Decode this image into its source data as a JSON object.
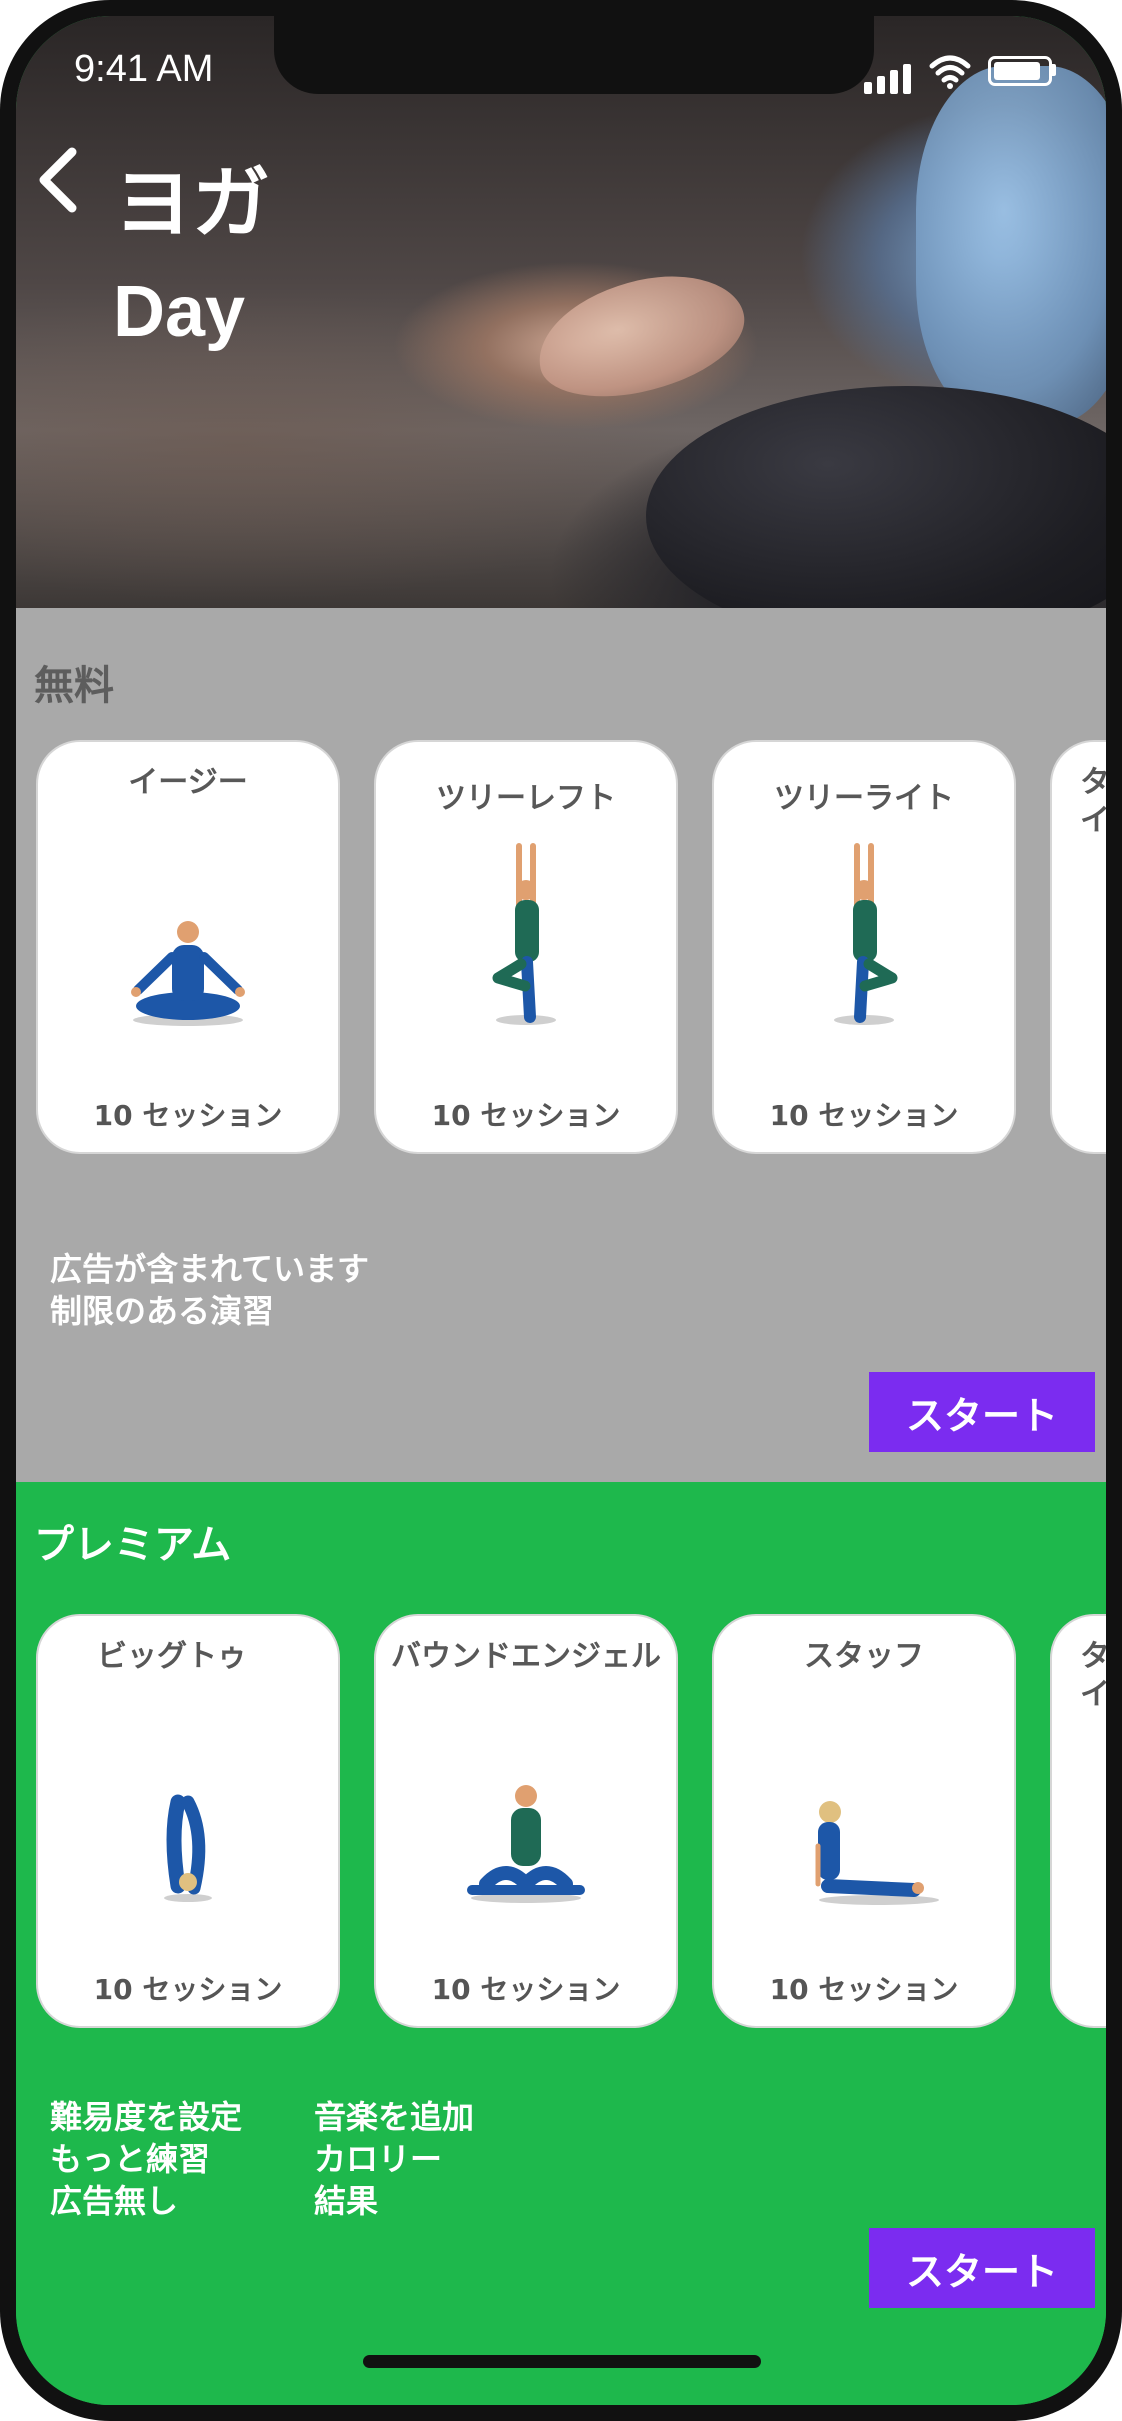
{
  "status": {
    "time": "9:41 AM"
  },
  "header": {
    "back_icon": "chevron-left-icon",
    "title": "ヨガ",
    "subtitle": "Day"
  },
  "free": {
    "title": "無料",
    "cards": [
      {
        "title": "イージー",
        "sessions": "10 セッション"
      },
      {
        "title": "ツリーレフト",
        "sessions": "10 セッション"
      },
      {
        "title": "ツリーライト",
        "sessions": "10 セッション"
      },
      {
        "title": "タ\nイ"
      }
    ],
    "features": [
      "広告が含まれています",
      "制限のある演習"
    ],
    "start_label": "スタート"
  },
  "premium": {
    "title": "プレミアム",
    "cards": [
      {
        "title": "ビッグトゥ",
        "sessions": "10 セッション"
      },
      {
        "title": "バウンドエンジェル",
        "sessions": "10 セッション"
      },
      {
        "title": "スタッフ",
        "sessions": "10 セッション"
      },
      {
        "title": "タ\nイ"
      }
    ],
    "features_left": [
      "難易度を設定",
      "もっと練習",
      "広告無し"
    ],
    "features_right": [
      "音楽を追加",
      "カロリー",
      "結果"
    ],
    "start_label": "スタート"
  },
  "colors": {
    "free_bg": "#a9a9a9",
    "premium_bg": "#1eb84c",
    "button": "#7b2cf0"
  }
}
